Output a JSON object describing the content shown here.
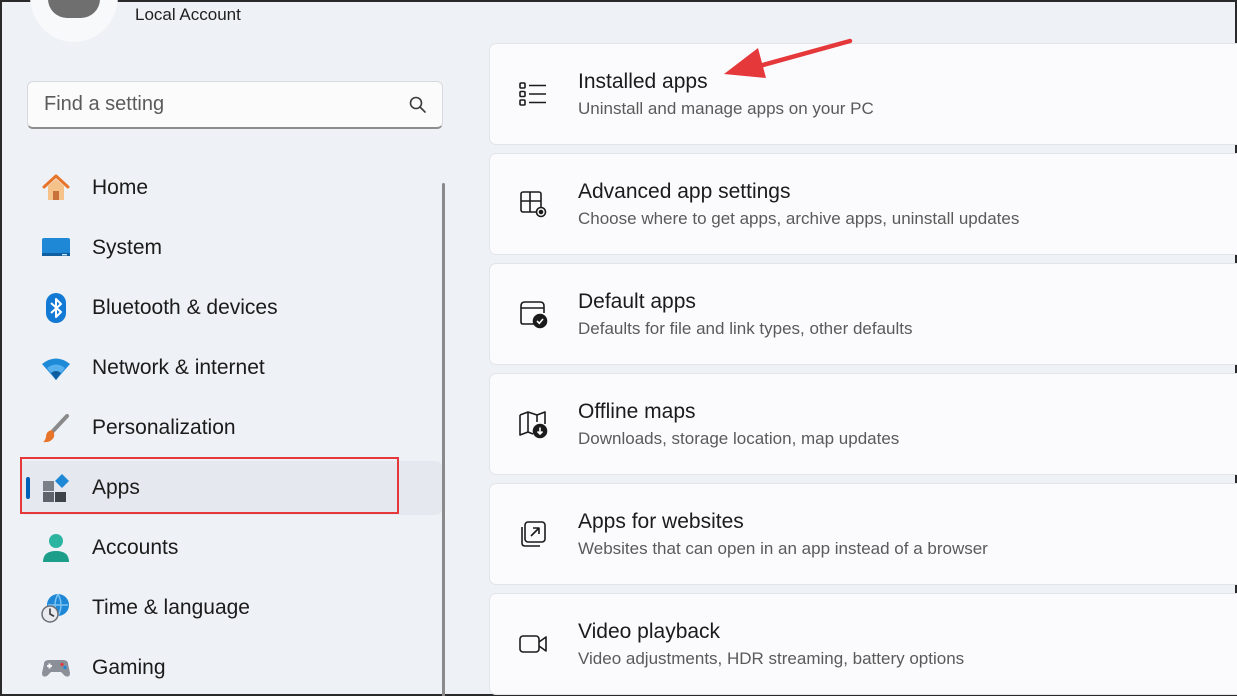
{
  "account": {
    "label": "Local Account"
  },
  "search": {
    "placeholder": "Find a setting"
  },
  "sidebar": {
    "items": [
      {
        "label": "Home"
      },
      {
        "label": "System"
      },
      {
        "label": "Bluetooth & devices"
      },
      {
        "label": "Network & internet"
      },
      {
        "label": "Personalization"
      },
      {
        "label": "Apps",
        "active": true
      },
      {
        "label": "Accounts"
      },
      {
        "label": "Time & language"
      },
      {
        "label": "Gaming"
      }
    ]
  },
  "main": {
    "cards": [
      {
        "title": "Installed apps",
        "desc": "Uninstall and manage apps on your PC"
      },
      {
        "title": "Advanced app settings",
        "desc": "Choose where to get apps, archive apps, uninstall updates"
      },
      {
        "title": "Default apps",
        "desc": "Defaults for file and link types, other defaults"
      },
      {
        "title": "Offline maps",
        "desc": "Downloads, storage location, map updates"
      },
      {
        "title": "Apps for websites",
        "desc": "Websites that can open in an app instead of a browser"
      },
      {
        "title": "Video playback",
        "desc": "Video adjustments, HDR streaming, battery options"
      }
    ]
  },
  "colors": {
    "accent": "#005fb8",
    "annotation": "#e5383b"
  }
}
